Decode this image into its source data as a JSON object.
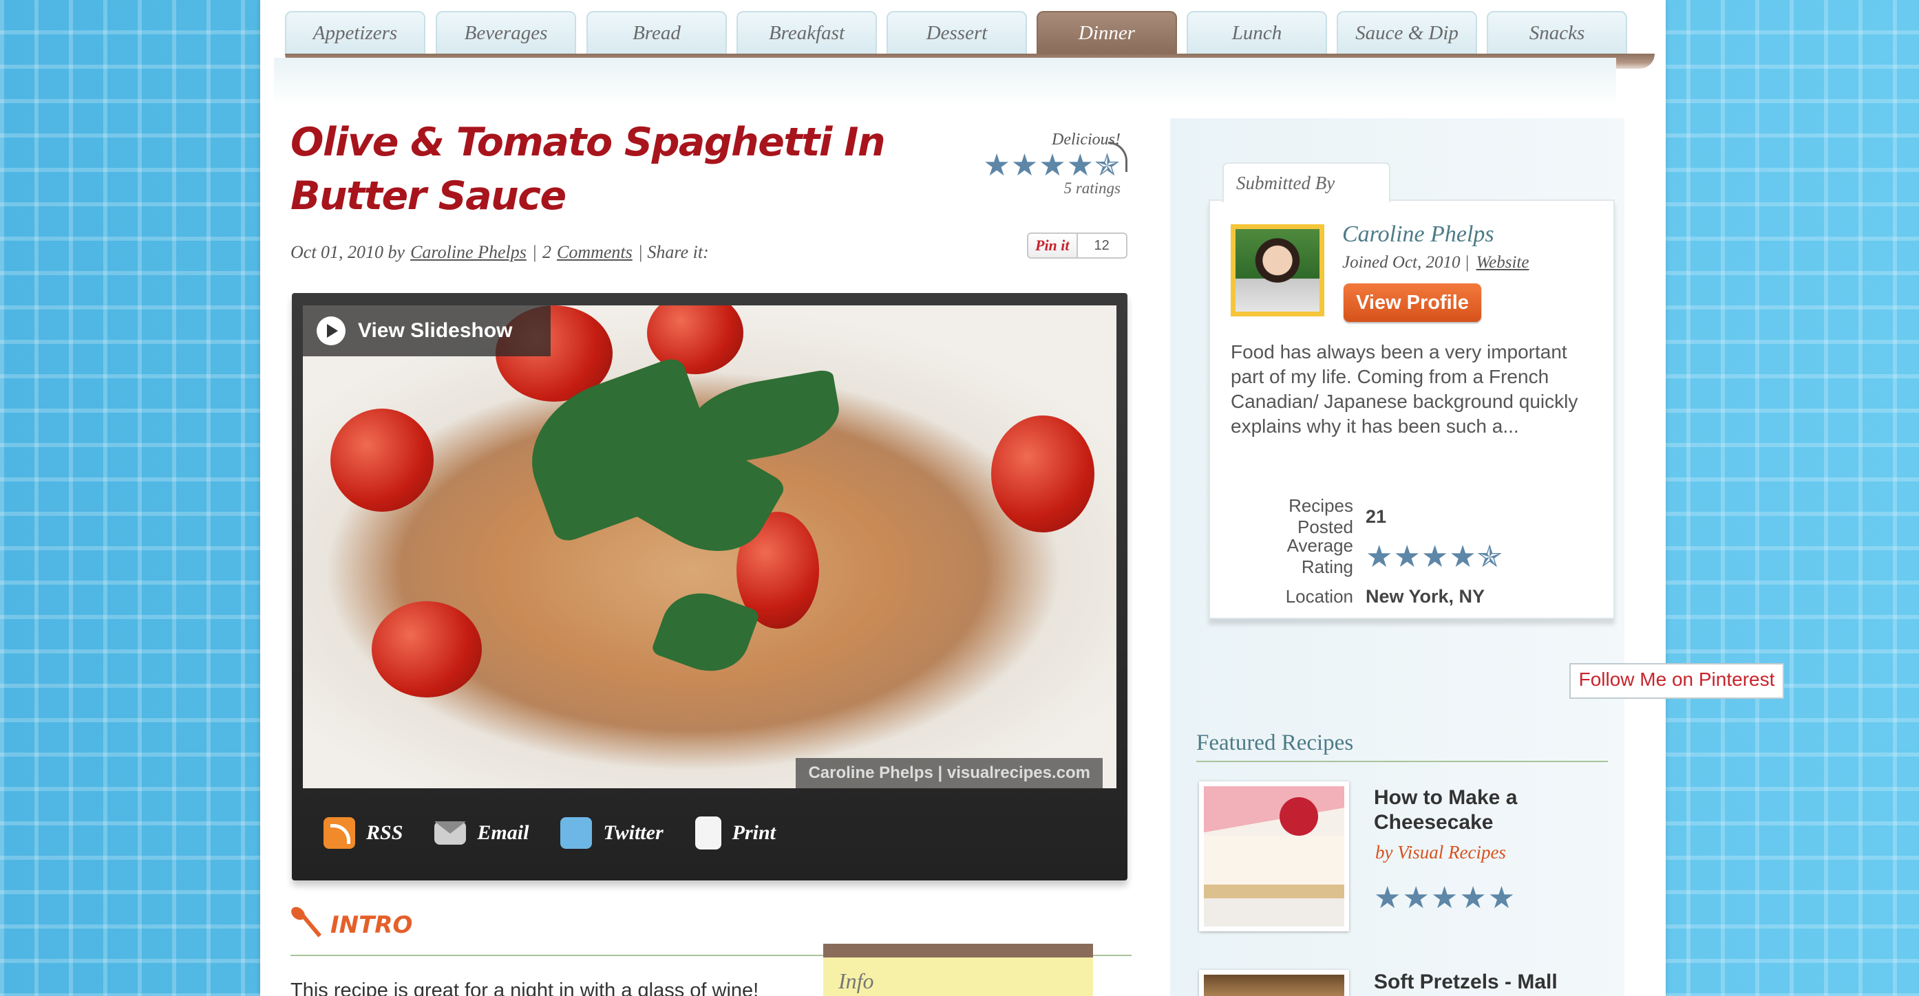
{
  "nav": {
    "tabs": [
      {
        "label": "Appetizers"
      },
      {
        "label": "Beverages"
      },
      {
        "label": "Bread"
      },
      {
        "label": "Breakfast"
      },
      {
        "label": "Dessert"
      },
      {
        "label": "Dinner"
      },
      {
        "label": "Lunch"
      },
      {
        "label": "Sauce & Dip"
      },
      {
        "label": "Snacks"
      }
    ],
    "active_tab": "Dinner"
  },
  "recipe": {
    "title": "Olive & Tomato Spaghetti In Butter Sauce",
    "rating_caption": "Delicious!",
    "rating_stars": "★★★★✯",
    "rating_value": 4.5,
    "ratings_count": "5 ratings",
    "date": "Oct 01, 2010 by",
    "author": "Caroline Phelps",
    "comments_count": "2",
    "comments_label": "Comments",
    "share_label": "| Share it:",
    "pin_label": "Pin it",
    "pin_count": "12"
  },
  "photo": {
    "slideshow_label": "View Slideshow",
    "watermark": "Caroline Phelps | visualrecipes.com"
  },
  "share": {
    "rss": "RSS",
    "email": "Email",
    "twitter": "Twitter",
    "print": "Print"
  },
  "intro": {
    "heading": "INTRO",
    "text": "This recipe is great for a night in with a glass of wine!",
    "info_label": "Info"
  },
  "sidebar": {
    "submitted_by": "Submitted By",
    "name": "Caroline Phelps",
    "joined": "Joined Oct, 2010 |",
    "website": "Website",
    "view_profile": "View Profile",
    "bio": "Food has always been a very important part of my life. Coming from a French Canadian/ Japanese background quickly explains why it has been such a...",
    "stats": {
      "recipes_label": "Recipes Posted",
      "recipes_value": "21",
      "rating_label": "Average Rating",
      "rating_stars": "★★★★✯",
      "rating_value": 4.5,
      "location_label": "Location",
      "location_value": "New York, NY"
    },
    "follow_label": "Follow Me on Pinterest",
    "featured_title": "Featured Recipes",
    "featured": [
      {
        "title": "How to Make a Cheesecake",
        "by": "by Visual Recipes",
        "stars": "★★★★★",
        "rating_value": 5
      },
      {
        "title": "Soft Pretzels - Mall"
      }
    ]
  },
  "colors": {
    "title_red": "#a8141c",
    "accent_orange": "#e4602a",
    "star_blue": "#5d86a7",
    "tab_brown": "#8a6c5a",
    "sidebar_teal": "#4c7b86"
  }
}
